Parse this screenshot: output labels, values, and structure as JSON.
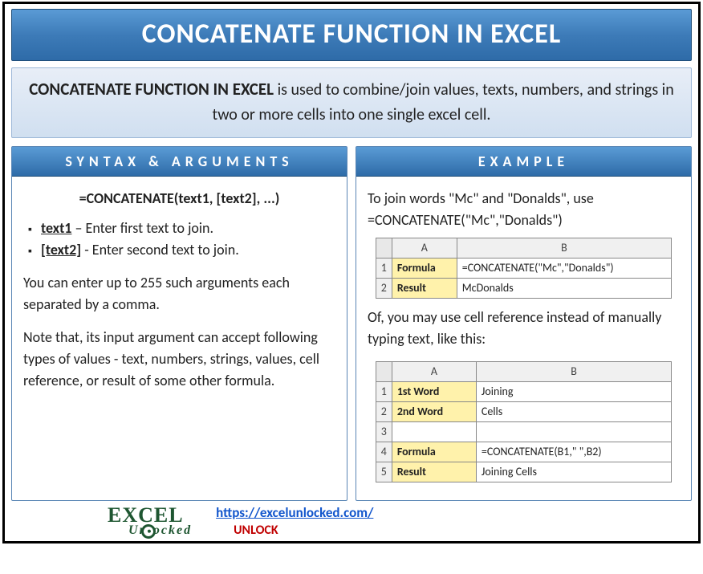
{
  "title": "CONCATENATE FUNCTION IN EXCEL",
  "description": {
    "lead": "CONCATENATE FUNCTION IN EXCEL",
    "rest": " is used to combine/join values, texts, numbers, and strings in two or more cells into one single excel cell."
  },
  "syntax": {
    "header": "SYNTAX & ARGUMENTS",
    "formula": "=CONCATENATE(text1, [text2], ...)",
    "args": [
      {
        "name": "text1",
        "desc": " – Enter first text to join."
      },
      {
        "name": "[text2]",
        "desc": " - Enter second text to join."
      }
    ],
    "note1": "You can enter up to 255 such arguments each separated by a comma.",
    "note2": "Note that, its input argument can accept following types of values - text, numbers, strings, values, cell reference, or result of some other formula."
  },
  "example": {
    "header": "EXAMPLE",
    "intro1": "To join words \"Mc\" and \"Donalds\", use",
    "intro2": "=CONCATENATE(\"Mc\",\"Donalds\")",
    "table1": {
      "colA": "A",
      "colB": "B",
      "rows": [
        {
          "n": "1",
          "a": "Formula",
          "b": "=CONCATENATE(\"Mc\",\"Donalds\")"
        },
        {
          "n": "2",
          "a": "Result",
          "b": "McDonalds"
        }
      ]
    },
    "mid": "Of, you may use cell reference instead of manually typing text, like this:",
    "table2": {
      "colA": "A",
      "colB": "B",
      "rows": [
        {
          "n": "1",
          "a": "1st Word",
          "b": "Joining"
        },
        {
          "n": "2",
          "a": "2nd Word",
          "b": "Cells"
        },
        {
          "n": "3",
          "a": "",
          "b": ""
        },
        {
          "n": "4",
          "a": "Formula",
          "b": "=CONCATENATE(B1,\" \",B2)"
        },
        {
          "n": "5",
          "a": "Result",
          "b": "Joining Cells"
        }
      ]
    }
  },
  "footer": {
    "logo_top": "EXCEL",
    "logo_bot": "Unlocked",
    "url": "https://excelunlocked.com/",
    "unlock": "UNLOCK"
  }
}
